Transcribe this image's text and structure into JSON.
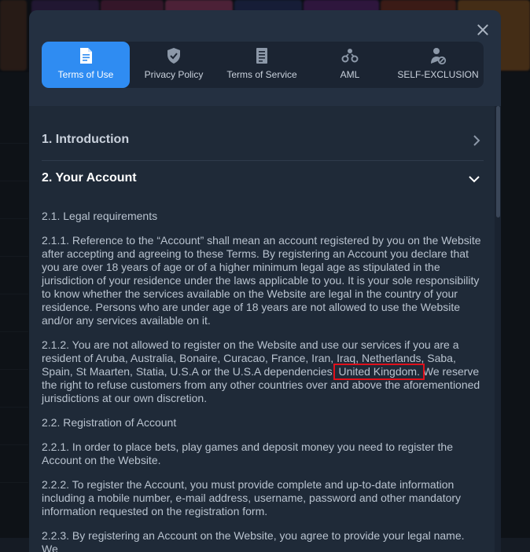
{
  "modal": {
    "tabs": [
      {
        "label": "Terms of Use",
        "icon": "document-icon",
        "active": true
      },
      {
        "label": "Privacy Policy",
        "icon": "shield-check-icon",
        "active": false
      },
      {
        "label": "Terms of Service",
        "icon": "printed-document-icon",
        "active": false
      },
      {
        "label": "AML",
        "icon": "users-network-icon",
        "active": false
      },
      {
        "label": "SELF-EXCLUSION",
        "icon": "user-blocked-icon",
        "active": false
      }
    ],
    "colors": {
      "accent": "#2f8cf2",
      "highlight_box": "#e0101b"
    }
  },
  "sections": [
    {
      "title": "1. Introduction",
      "expanded": false
    },
    {
      "title": "2. Your Account",
      "expanded": true
    }
  ],
  "content": {
    "h_2_1": "2.1. Legal requirements",
    "p_2_1_1": "2.1.1. Reference to the “Account” shall mean an account registered by you on the Website after accepting and agreeing to these Terms. By registering an Account you declare that you are over 18 years of age or of a higher minimum legal age as stipulated in the jurisdiction of your residence under the laws applicable to you. It is your sole responsibility to know whether the services available on the Website are legal in the country of your residence. Persons who are under age of 18 years are not allowed to use the Website and/or any services available on it.",
    "p_2_1_2_a": "2.1.2. You are not allowed to register on the Website and use our services if you are a resident of Aruba, Australia, Bonaire, Curacao, France, Iran, Iraq, Netherlands, Saba, Spain, St Maarten, Statia, U.S.A or the U.S.A dependencies,",
    "p_2_1_2_highlight": "United Kingdom.",
    "p_2_1_2_b": "We reserve the right to refuse customers from any other countries over and above the aforementioned jurisdictions at our own discretion.",
    "h_2_2": "2.2. Registration of Account",
    "p_2_2_1": "2.2.1. In order to place bets, play games and deposit money you need to register the Account on the Website.",
    "p_2_2_2": "2.2.2. To register the Account, you must provide complete and up-to-date information including a mobile number, e-mail address, username, password and other mandatory information requested on the registration form.",
    "p_2_2_3": "2.2.3. By registering an Account on the Website, you agree to provide your legal name. We"
  }
}
